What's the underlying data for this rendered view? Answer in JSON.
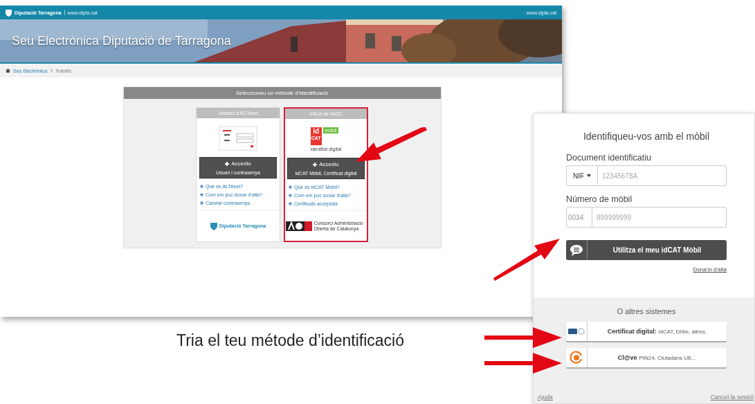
{
  "back_window": {
    "header": {
      "logo_text": "Diputació Tarragona",
      "site_url": "www.dipta.cat",
      "right_url": "www.dipta.cat"
    },
    "banner": {
      "title": "Seu Electrònica Diputació de Tarragona"
    },
    "breadcrumb": [
      {
        "label": "Seu Electrònica",
        "link": true
      },
      {
        "label": "Tràmits",
        "link": false
      }
    ],
    "method_box": {
      "title": "Seleccioneu un mètode d'identificació",
      "cards": [
        {
          "title": "Usuaris d'ALTAnet",
          "kind": "login-form",
          "selected": false,
          "button": {
            "label": "Accediu",
            "sublabel": "Usuari i contrasenya"
          },
          "links": [
            "Què és ALTAnet?",
            "Com em puc donar d'alta?",
            "Canviar contrasenya"
          ],
          "footer": {
            "kind": "dipta",
            "text": "Diputació Tarragona"
          }
        },
        {
          "title": "VÀLid de l'AOC",
          "kind": "idcat",
          "selected": true,
          "logo": {
            "id": "id",
            "cat": "CAT",
            "badge": "mòbil",
            "caption": "identitat digital"
          },
          "button": {
            "label": "Accediu",
            "sublabel": "idCAT Mòbil, Certificat digital"
          },
          "links": [
            "Què és idCAT Mòbil?",
            "Com em puc donar d'alta?",
            "Certificats acceptats"
          ],
          "footer": {
            "kind": "aoc",
            "text": "Consorci Administració Oberta de Catalunya"
          }
        }
      ]
    }
  },
  "front_panel": {
    "title": "Identifiqueu-vos amb el mòbil",
    "document": {
      "label": "Document identificatiu",
      "type": "NIF",
      "placeholder": "12345678A"
    },
    "mobile": {
      "label": "Número de mòbil",
      "prefix": "0034",
      "placeholder": "999999999"
    },
    "submit": "Utilitza el meu idCAT Mòbil",
    "signup_link": "Dona'm d'alta",
    "others_title": "O altres sistemes",
    "options": [
      {
        "kind": "dni",
        "bold": "Certificat digital:",
        "text": "idCAT, DNIe, altres."
      },
      {
        "kind": "clave",
        "bold": "Cl@ve",
        "text": "PIN24, Ciutadans UE..."
      }
    ],
    "footer_links": [
      "Ajuda",
      "Cancel·la sessió"
    ]
  },
  "caption": "Tria el teu métode d’identificació"
}
